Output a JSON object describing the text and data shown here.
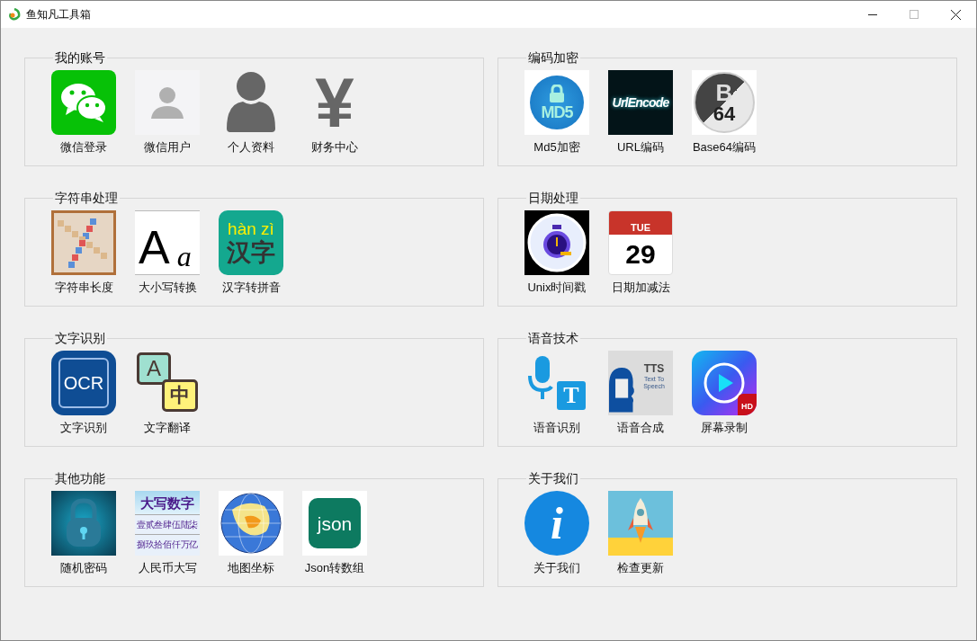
{
  "window": {
    "title": "鱼知凡工具箱"
  },
  "columns": [
    [
      {
        "title": "我的账号",
        "tools": [
          {
            "label": "微信登录",
            "kind": "wechat"
          },
          {
            "label": "微信用户",
            "kind": "user-placeholder"
          },
          {
            "label": "个人资料",
            "kind": "person"
          },
          {
            "label": "财务中心",
            "kind": "yen",
            "icon_text": [
              "¥"
            ]
          }
        ]
      },
      {
        "title": "字符串处理",
        "tools": [
          {
            "label": "字符串长度",
            "kind": "tiles"
          },
          {
            "label": "大小写转换",
            "kind": "letters",
            "icon_text": [
              "A",
              "a"
            ]
          },
          {
            "label": "汉字转拼音",
            "kind": "hanzi",
            "icon_text": [
              "hàn zì",
              "汉字"
            ]
          }
        ]
      },
      {
        "title": "文字识别",
        "tools": [
          {
            "label": "文字识别",
            "kind": "ocr",
            "icon_text": [
              "OCR"
            ]
          },
          {
            "label": "文字翻译",
            "kind": "translate",
            "icon_text": [
              "A",
              "中"
            ]
          }
        ]
      },
      {
        "title": "其他功能",
        "tools": [
          {
            "label": "随机密码",
            "kind": "padlock"
          },
          {
            "label": "人民币大写",
            "kind": "numerals",
            "icon_text": [
              "大写数字",
              "壹贰叁肆伍陆柒",
              "捌玖拾佰仟万亿"
            ]
          },
          {
            "label": "地图坐标",
            "kind": "globe"
          },
          {
            "label": "Json转数组",
            "kind": "json",
            "icon_text": [
              "json"
            ]
          }
        ]
      }
    ],
    [
      {
        "title": "编码加密",
        "tools": [
          {
            "label": "Md5加密",
            "kind": "md5",
            "icon_text": [
              "MD5"
            ]
          },
          {
            "label": "URL编码",
            "kind": "urlencode",
            "icon_text": [
              "UrlEncode"
            ]
          },
          {
            "label": "Base64编码",
            "kind": "base64",
            "icon_text": [
              "B",
              "64"
            ]
          }
        ]
      },
      {
        "title": "日期处理",
        "tools": [
          {
            "label": "Unix时间戳",
            "kind": "stopwatch"
          },
          {
            "label": "日期加减法",
            "kind": "calendar",
            "icon_text": [
              "TUE",
              "29"
            ]
          }
        ]
      },
      {
        "title": "语音技术",
        "tools": [
          {
            "label": "语音识别",
            "kind": "mic",
            "icon_text": [
              "T"
            ]
          },
          {
            "label": "语音合成",
            "kind": "tts",
            "icon_text": [
              "TTS",
              "Text To Speech"
            ]
          },
          {
            "label": "屏幕录制",
            "kind": "video",
            "icon_text": [
              "HD"
            ]
          }
        ]
      },
      {
        "title": "关于我们",
        "tools": [
          {
            "label": "关于我们",
            "kind": "info",
            "icon_text": [
              "i"
            ]
          },
          {
            "label": "检查更新",
            "kind": "rocket"
          }
        ]
      }
    ]
  ]
}
